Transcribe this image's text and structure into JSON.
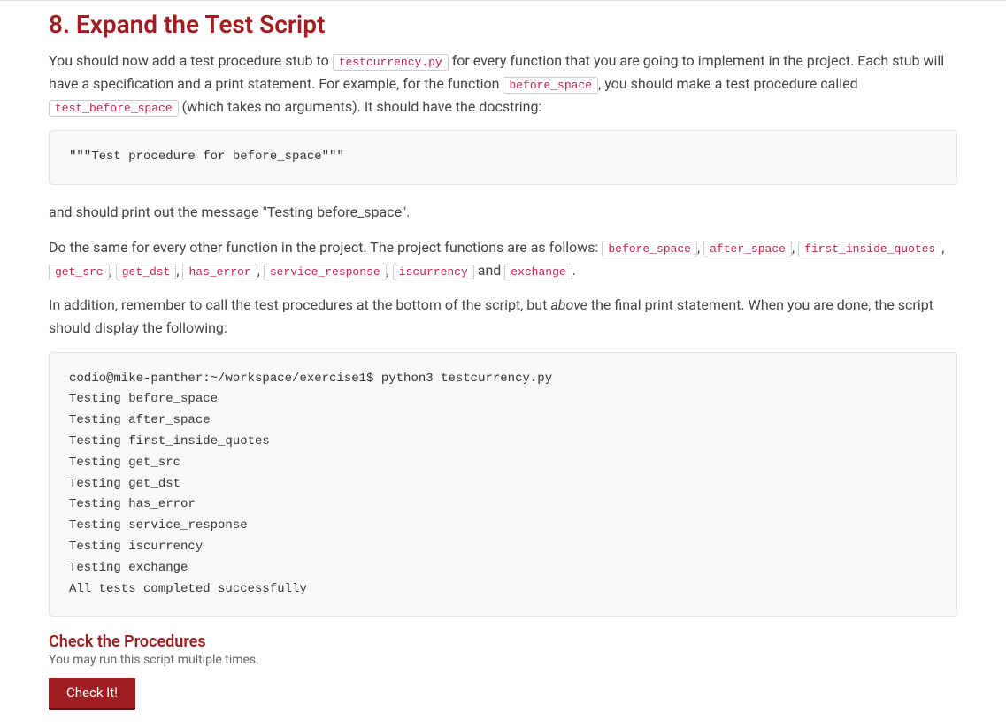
{
  "section": {
    "title": "8. Expand the Test Script",
    "para1_part1": "You should now add a test procedure stub to ",
    "code_testcurrency": "testcurrency.py",
    "para1_part2": " for every function that you are going to implement in the project. Each stub will have a specification and a print statement. For example, for the function ",
    "code_before_space": "before_space",
    "para1_part3": ", you should make a test procedure called ",
    "code_test_before_space": "test_before_space",
    "para1_part4": " (which takes no arguments). It should have the docstring:",
    "codeblock1": "\"\"\"Test procedure for before_space\"\"\"",
    "para2": "and should print out the message \"Testing before_space\".",
    "para3_part1": "Do the same for every other function in the project. The project functions are as follows: ",
    "fn_before_space": "before_space",
    "sep_comma": ", ",
    "fn_after_space": "after_space",
    "fn_first_inside_quotes": "first_inside_quotes",
    "fn_get_src": "get_src",
    "fn_get_dst": "get_dst",
    "fn_has_error": "has_error",
    "fn_service_response": "service_response",
    "fn_iscurrency": "iscurrency",
    "and_text": " and ",
    "fn_exchange": "exchange",
    "period": ".",
    "para4_part1": "In addition, remember to call the test procedures at the bottom of the script, but ",
    "para4_italic": "above",
    "para4_part2": " the final print statement. When you are done, the script should display the following:",
    "codeblock2": "codio@mike-panther:~/workspace/exercise1$ python3 testcurrency.py\nTesting before_space\nTesting after_space\nTesting first_inside_quotes\nTesting get_src\nTesting get_dst\nTesting has_error\nTesting service_response\nTesting iscurrency\nTesting exchange\nAll tests completed successfully",
    "check_title": "Check the Procedures",
    "check_subtitle": "You may run this script multiple times.",
    "check_button": "Check It!"
  }
}
